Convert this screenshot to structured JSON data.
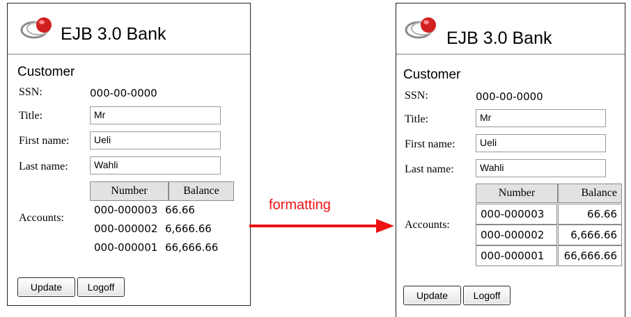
{
  "colors": {
    "annotation": "#ee1111",
    "header_rule": "#b8b8b8",
    "table_header_bg": "#e2e2e2",
    "logo_primary": "#d21f1f",
    "logo_ring": "#8a8a8a"
  },
  "icons": {
    "logo": "bank-logo-icon",
    "arrow": "arrow-right-icon"
  },
  "annotation": {
    "label": "formatting"
  },
  "left": {
    "app_title": "EJB 3.0 Bank",
    "section_title": "Customer",
    "fields": {
      "ssn_label": "SSN:",
      "ssn_value": "000-00-0000",
      "title_label": "Title:",
      "title_value": "Mr",
      "first_name_label": "First name:",
      "first_name_value": "Ueli",
      "last_name_label": "Last name:",
      "last_name_value": "Wahli",
      "accounts_label": "Accounts:"
    },
    "accounts": {
      "headers": [
        "Number",
        "Balance"
      ],
      "rows": [
        [
          "000-000003",
          "66.66"
        ],
        [
          "000-000002",
          "6,666.66"
        ],
        [
          "000-000001",
          "66,666.66"
        ]
      ]
    },
    "buttons": {
      "update": "Update",
      "logoff": "Logoff"
    }
  },
  "right": {
    "app_title": "EJB 3.0 Bank",
    "section_title": "Customer",
    "fields": {
      "ssn_label": "SSN:",
      "ssn_value": "000-00-0000",
      "title_label": "Title:",
      "title_value": "Mr",
      "first_name_label": "First name:",
      "first_name_value": "Ueli",
      "last_name_label": "Last name:",
      "last_name_value": "Wahli",
      "accounts_label": "Accounts:"
    },
    "accounts": {
      "headers": [
        "Number",
        "Balance"
      ],
      "rows": [
        [
          "000-000003",
          "66.66"
        ],
        [
          "000-000002",
          "6,666.66"
        ],
        [
          "000-000001",
          "66,666.66"
        ]
      ]
    },
    "buttons": {
      "update": "Update",
      "logoff": "Logoff"
    }
  }
}
